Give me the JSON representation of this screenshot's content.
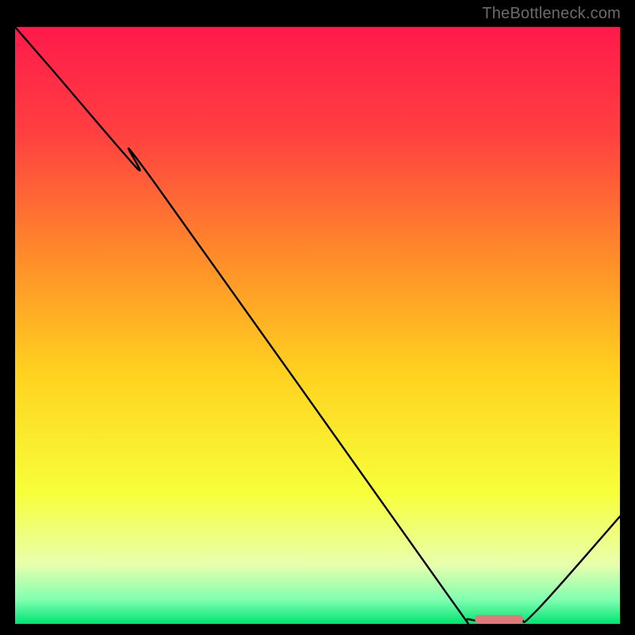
{
  "watermark": "TheBottleneck.com",
  "chart_data": {
    "type": "line",
    "title": "",
    "xlabel": "",
    "ylabel": "",
    "xlim": [
      0,
      100
    ],
    "ylim": [
      0,
      100
    ],
    "grid": false,
    "legend": false,
    "gradient_stops": [
      {
        "pct": 0,
        "color": "#ff1a4b"
      },
      {
        "pct": 18,
        "color": "#ff4040"
      },
      {
        "pct": 38,
        "color": "#ff8a2a"
      },
      {
        "pct": 58,
        "color": "#ffd21f"
      },
      {
        "pct": 78,
        "color": "#f7ff3a"
      },
      {
        "pct": 90,
        "color": "#e8ffad"
      },
      {
        "pct": 96,
        "color": "#7fffb0"
      },
      {
        "pct": 100,
        "color": "#00e371"
      }
    ],
    "series": [
      {
        "name": "bottleneck-curve",
        "color": "#000000",
        "x": [
          0,
          6,
          20,
          23,
          72,
          75,
          83,
          86,
          100
        ],
        "values": [
          100,
          93,
          76.5,
          74,
          4.2,
          0.8,
          0.8,
          2.0,
          18
        ]
      }
    ],
    "marker": {
      "name": "optimal-range",
      "color": "#e07a7a",
      "x_start": 76,
      "x_end": 84,
      "y": 0.8,
      "thickness_pct": 1.4
    }
  }
}
